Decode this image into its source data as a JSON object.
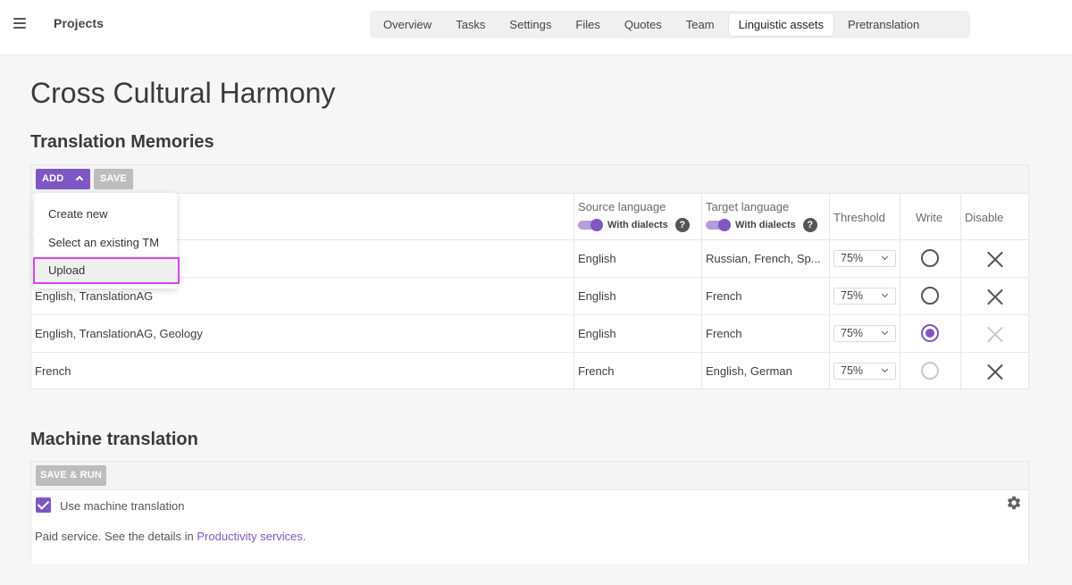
{
  "header": {
    "app_title": "Projects",
    "tabs": [
      {
        "label": "Overview"
      },
      {
        "label": "Tasks"
      },
      {
        "label": "Settings"
      },
      {
        "label": "Files"
      },
      {
        "label": "Quotes"
      },
      {
        "label": "Team"
      },
      {
        "label": "Linguistic assets",
        "active": true
      },
      {
        "label": "Pretranslation"
      }
    ]
  },
  "page": {
    "title": "Cross Cultural Harmony"
  },
  "tm": {
    "title": "Translation Memories",
    "add_label": "ADD",
    "save_label": "SAVE",
    "menu": [
      "Create new",
      "Select an existing TM",
      "Upload"
    ],
    "menu_highlighted_index": 2,
    "columns": {
      "source": "Source language",
      "target": "Target language",
      "dialects": "With dialects",
      "help": "?",
      "threshold": "Threshold",
      "write": "Write",
      "disable": "Disable"
    },
    "rows": [
      {
        "name": "",
        "source": "English",
        "target": "Russian, French, Sp...",
        "threshold": "75%",
        "write": "unchecked",
        "disable": "active"
      },
      {
        "name": "English, TranslationAG",
        "source": "English",
        "target": "French",
        "threshold": "75%",
        "write": "unchecked",
        "disable": "active"
      },
      {
        "name": "English, TranslationAG, Geology",
        "source": "English",
        "target": "French",
        "threshold": "75%",
        "write": "checked",
        "disable": "inactive"
      },
      {
        "name": "French",
        "source": "French",
        "target": "English, German",
        "threshold": "75%",
        "write": "disabled",
        "disable": "active"
      }
    ]
  },
  "mt": {
    "title": "Machine translation",
    "save_run_label": "SAVE & RUN",
    "use_label": "Use machine translation",
    "use_checked": true,
    "paid_text": "Paid service. See the details in ",
    "paid_link": "Productivity services",
    "paid_end": "."
  },
  "colors": {
    "accent": "#7e57c2",
    "highlight_outline": "#d946ef"
  },
  "icons": [
    "hamburger-icon",
    "chevron-up-icon",
    "help-icon",
    "chevron-down-icon",
    "radio-icon",
    "close-icon",
    "gear-icon",
    "checkmark-icon"
  ]
}
